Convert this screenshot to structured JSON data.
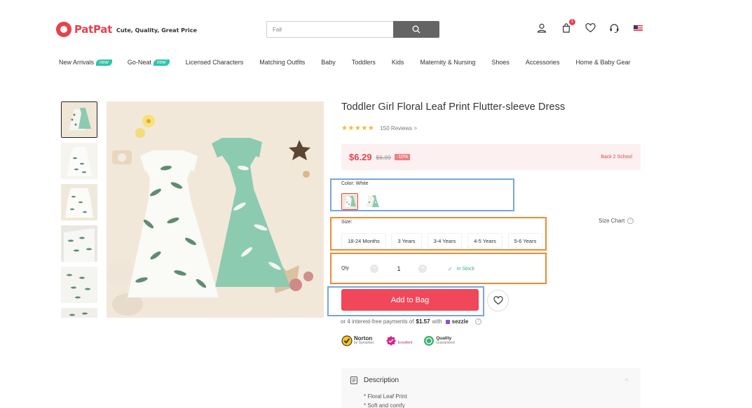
{
  "header": {
    "logo_text": "PatPat",
    "tagline": "Cute, Quality, Great Price",
    "search_placeholder": "Fall",
    "cart_count": "1"
  },
  "nav": [
    {
      "label": "New Arrivals",
      "badge": "new"
    },
    {
      "label": "Go-Neat",
      "badge": "new"
    },
    {
      "label": "Licensed Characters"
    },
    {
      "label": "Matching Outfits"
    },
    {
      "label": "Baby"
    },
    {
      "label": "Toddlers"
    },
    {
      "label": "Kids"
    },
    {
      "label": "Maternity & Nursing"
    },
    {
      "label": "Shoes"
    },
    {
      "label": "Accessories"
    },
    {
      "label": "Home & Baby Gear"
    }
  ],
  "product": {
    "title": "Toddler Girl Floral Leaf Print Flutter-sleeve Dress",
    "reviews": "150 Reviews >",
    "rating_stars": 5,
    "price": "$6.29",
    "old_price": "$6.99",
    "discount": "-10%",
    "promo": "Back 2 School",
    "color_label": "Color: White",
    "size_label": "Size:",
    "size_chart": "Size Chart",
    "sizes": [
      "18-24 Months",
      "3 Years",
      "3-4 Years",
      "4-5 Years",
      "5-6 Years"
    ],
    "qty_label": "Qty",
    "qty": "1",
    "stock": "In Stock",
    "add_to_bag": "Add to Bag",
    "installment_prefix": "or 4 interest-free payments of",
    "installment_amount": "$1.57",
    "installment_with": "with",
    "sezzle": "sezzle",
    "badges": {
      "norton": "Norton",
      "norton_sub": "by Symantec",
      "reseller": "Excellent",
      "quality": "Quality",
      "quality_sub": "Guaranteed"
    },
    "description_title": "Description",
    "description_lines": [
      "* Floral Leaf Print",
      "* Soft and comfy"
    ]
  },
  "colors": {
    "brand": "#e8414e",
    "add_button": "#f0485a",
    "price_bg": "#fdf0f1",
    "highlight_blue": "#7aa5da",
    "highlight_orange": "#ee8a2d",
    "in_stock": "#3ab07a",
    "star": "#f5b82e"
  },
  "icons": [
    "search-icon",
    "user-icon",
    "cart-icon",
    "heart-icon",
    "headset-icon",
    "us-flag-icon",
    "check-icon",
    "info-icon",
    "description-icon",
    "chevron-up-icon",
    "minus-icon",
    "plus-icon"
  ]
}
